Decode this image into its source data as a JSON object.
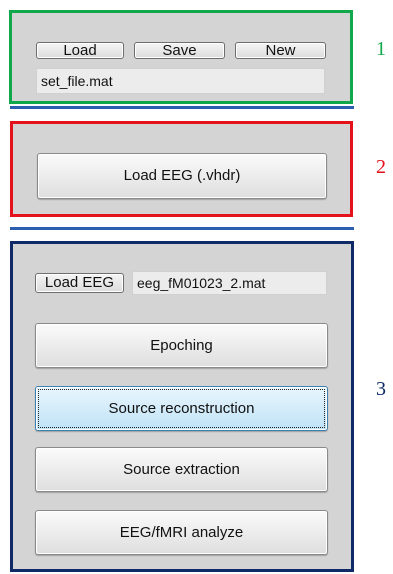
{
  "panel1": {
    "buttons": {
      "load": "Load",
      "save": "Save",
      "new": "New"
    },
    "file_field": "set_file.mat",
    "number": "1",
    "number_color": "#10a84a"
  },
  "panel2": {
    "load_eeg_vhdr": "Load EEG (.vhdr)",
    "number": "2",
    "number_color": "#e3121b"
  },
  "panel3": {
    "load_eeg": "Load EEG",
    "eeg_file_field": "eeg_fM01023_2.mat",
    "buttons": {
      "epoching": "Epoching",
      "source_reconstruction": "Source reconstruction",
      "source_extraction": "Source extraction",
      "eeg_fmri_analyze": "EEG/fMRI analyze"
    },
    "number": "3",
    "number_color": "#0f2a66"
  }
}
